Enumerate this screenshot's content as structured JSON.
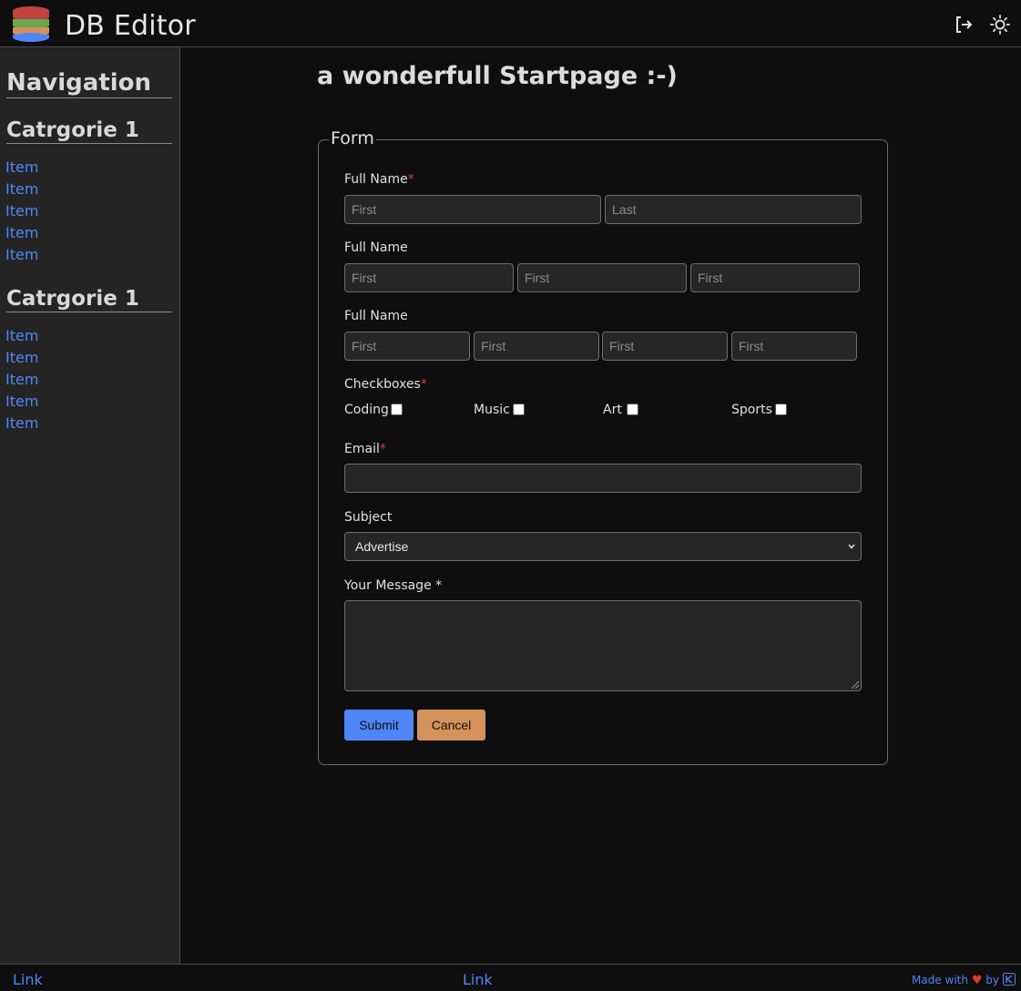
{
  "header": {
    "title": "DB Editor",
    "logo_icon": "database-icon",
    "logout_icon": "logout-icon",
    "theme_icon": "sun-icon"
  },
  "sidebar": {
    "title": "Navigation",
    "categories": [
      {
        "title": "Catrgorie 1",
        "items": [
          "Item",
          "Item",
          "Item",
          "Item",
          "Item"
        ]
      },
      {
        "title": "Catrgorie 1",
        "items": [
          "Item",
          "Item",
          "Item",
          "Item",
          "Item"
        ]
      }
    ]
  },
  "main": {
    "title": "a wonderfull Startpage :-)"
  },
  "form": {
    "legend": "Form",
    "required_marker": "*",
    "row1": {
      "label": "Full Name",
      "required": true,
      "placeholders": [
        "First",
        "Last"
      ]
    },
    "row2": {
      "label": "Full Name",
      "placeholders": [
        "First",
        "First",
        "First"
      ]
    },
    "row3": {
      "label": "Full Name",
      "placeholders": [
        "First",
        "First",
        "First",
        "First"
      ]
    },
    "checkboxes": {
      "label": "Checkboxes",
      "required": true,
      "options": [
        {
          "label": "Coding",
          "checked": false
        },
        {
          "label": "Music",
          "checked": false
        },
        {
          "label": "Art",
          "checked": false
        },
        {
          "label": "Sports",
          "checked": false
        }
      ]
    },
    "email": {
      "label": "Email",
      "required": true,
      "value": ""
    },
    "subject": {
      "label": "Subject",
      "selected": "Advertise"
    },
    "message": {
      "label": "Your Message *",
      "value": ""
    },
    "submit_label": "Submit",
    "cancel_label": "Cancel"
  },
  "footer": {
    "link_left": "Link",
    "link_center": "Link",
    "made_with": "Made with",
    "by": "by"
  },
  "colors": {
    "accent": "#4f86f7",
    "cancel": "#d4925a",
    "required": "#e03a3a",
    "background": "#0e0e0e",
    "sidebar": "#242424"
  }
}
